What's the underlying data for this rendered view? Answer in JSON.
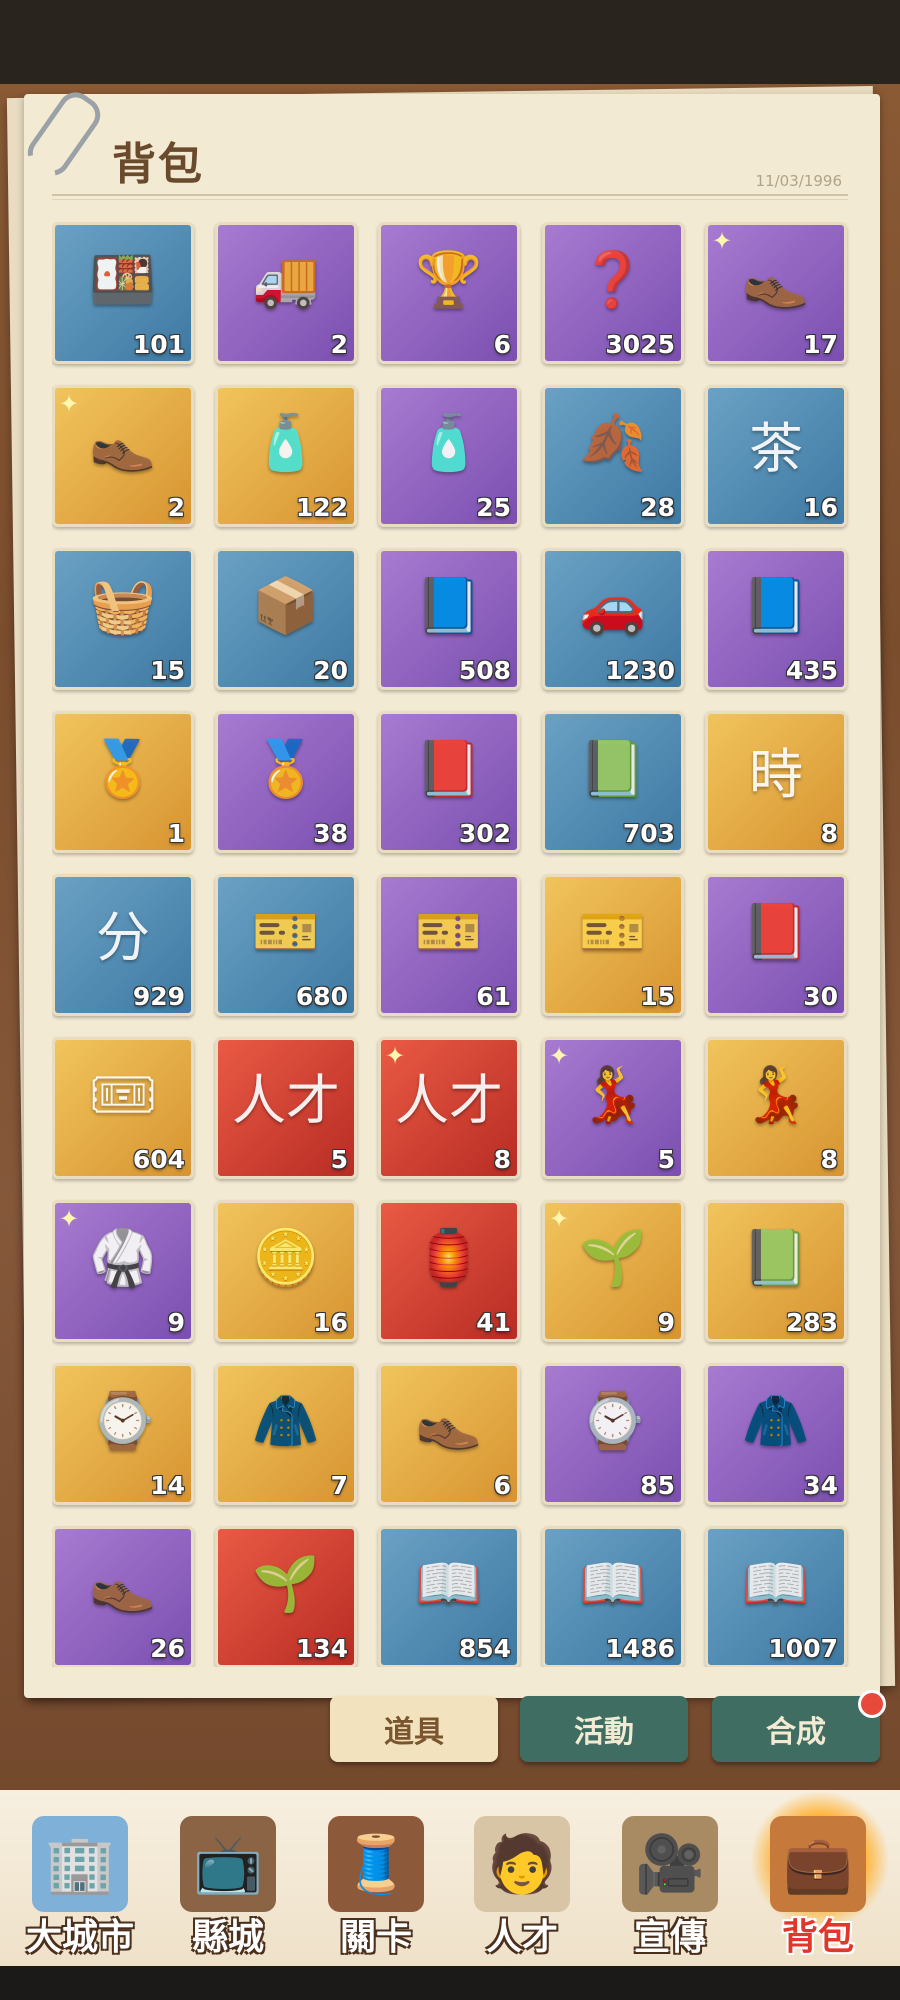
{
  "header": {
    "title": "背包",
    "date": "11/03/1996"
  },
  "items": [
    {
      "icon": "🍱",
      "color": "blue",
      "count": "101"
    },
    {
      "icon": "🚚",
      "color": "purple",
      "count": "2"
    },
    {
      "icon": "🏆",
      "color": "purple",
      "count": "6"
    },
    {
      "icon": "❓",
      "color": "purple",
      "count": "3025"
    },
    {
      "icon": "👞",
      "color": "purple",
      "count": "17",
      "sparkle": "✦"
    },
    {
      "icon": "👞",
      "color": "gold",
      "count": "2",
      "sparkle": "✦"
    },
    {
      "icon": "🧴",
      "color": "gold",
      "count": "122"
    },
    {
      "icon": "🧴",
      "color": "purple",
      "count": "25"
    },
    {
      "icon": "🍂",
      "color": "blue",
      "count": "28"
    },
    {
      "icon": "茶",
      "color": "blue",
      "count": "16"
    },
    {
      "icon": "🧺",
      "color": "blue",
      "count": "15"
    },
    {
      "icon": "📦",
      "color": "blue",
      "count": "20"
    },
    {
      "icon": "📘",
      "color": "purple",
      "count": "508"
    },
    {
      "icon": "🚗",
      "color": "blue",
      "count": "1230"
    },
    {
      "icon": "📘",
      "color": "purple",
      "count": "435"
    },
    {
      "icon": "🏅",
      "color": "gold",
      "count": "1"
    },
    {
      "icon": "🏅",
      "color": "purple",
      "count": "38"
    },
    {
      "icon": "📕",
      "color": "purple",
      "count": "302"
    },
    {
      "icon": "📗",
      "color": "blue",
      "count": "703"
    },
    {
      "icon": "時",
      "color": "gold",
      "count": "8"
    },
    {
      "icon": "分",
      "color": "blue",
      "count": "929"
    },
    {
      "icon": "🎫",
      "color": "blue",
      "count": "680"
    },
    {
      "icon": "🎫",
      "color": "purple",
      "count": "61"
    },
    {
      "icon": "🎫",
      "color": "gold",
      "count": "15"
    },
    {
      "icon": "📕",
      "color": "purple",
      "count": "30"
    },
    {
      "icon": "🎟",
      "color": "gold",
      "count": "604"
    },
    {
      "icon": "人才",
      "color": "red",
      "count": "5"
    },
    {
      "icon": "人才",
      "color": "red",
      "count": "8",
      "sparkle": "✦"
    },
    {
      "icon": "💃",
      "color": "purple",
      "count": "5",
      "sparkle": "✦"
    },
    {
      "icon": "💃",
      "color": "gold",
      "count": "8"
    },
    {
      "icon": "🥋",
      "color": "purple",
      "count": "9",
      "sparkle": "✦"
    },
    {
      "icon": "🪙",
      "color": "gold",
      "count": "16"
    },
    {
      "icon": "🏮",
      "color": "red",
      "count": "41"
    },
    {
      "icon": "🌱",
      "color": "gold",
      "count": "9",
      "sparkle": "✦"
    },
    {
      "icon": "📗",
      "color": "gold",
      "count": "283"
    },
    {
      "icon": "⌚",
      "color": "gold",
      "count": "14"
    },
    {
      "icon": "🧥",
      "color": "gold",
      "count": "7"
    },
    {
      "icon": "👞",
      "color": "gold",
      "count": "6"
    },
    {
      "icon": "⌚",
      "color": "purple",
      "count": "85"
    },
    {
      "icon": "🧥",
      "color": "purple",
      "count": "34"
    },
    {
      "icon": "👞",
      "color": "purple",
      "count": "26"
    },
    {
      "icon": "🌱",
      "color": "red",
      "count": "134"
    },
    {
      "icon": "📖",
      "color": "blue",
      "count": "854"
    },
    {
      "icon": "📖",
      "color": "blue",
      "count": "1486"
    },
    {
      "icon": "📖",
      "color": "blue",
      "count": "1007"
    }
  ],
  "tabs": [
    {
      "label": "道具"
    },
    {
      "label": "活動"
    },
    {
      "label": "合成"
    }
  ],
  "nav": [
    {
      "label": "大城市",
      "icon": "🏢"
    },
    {
      "label": "縣城",
      "icon": "📺"
    },
    {
      "label": "關卡",
      "icon": "🧵"
    },
    {
      "label": "人才",
      "icon": "🧑"
    },
    {
      "label": "宣傳",
      "icon": "🎥"
    },
    {
      "label": "背包",
      "icon": "💼"
    }
  ]
}
